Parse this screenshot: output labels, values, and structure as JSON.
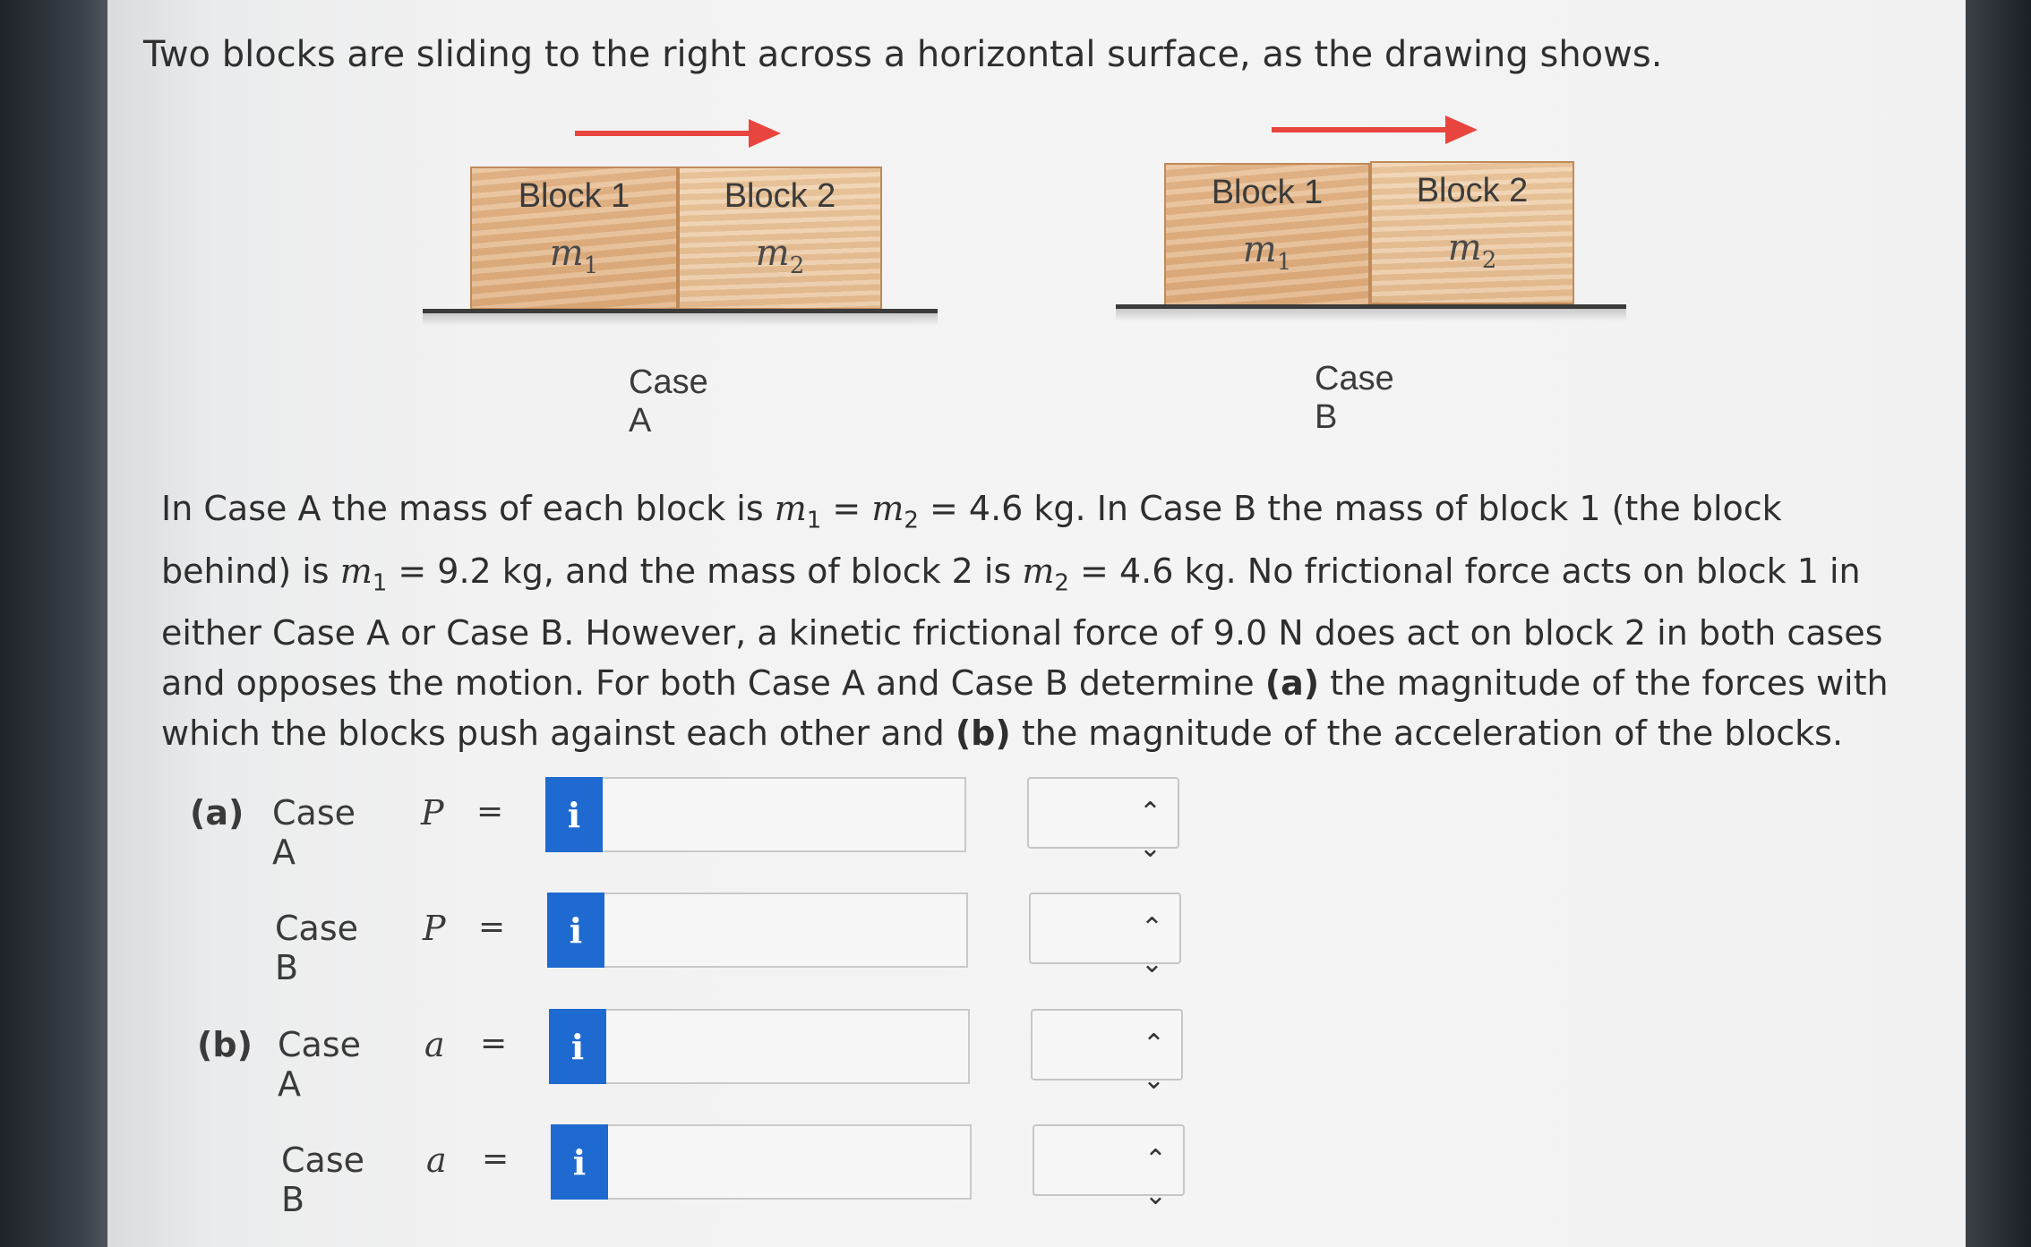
{
  "intro": "Two blocks are sliding to the right across a horizontal surface, as the drawing shows.",
  "figures": [
    {
      "block1_label": "Block 1",
      "block1_mass_symbol": "m",
      "block1_mass_sub": "1",
      "block2_label": "Block 2",
      "block2_mass_symbol": "m",
      "block2_mass_sub": "2",
      "caption": "Case A"
    },
    {
      "block1_label": "Block 1",
      "block1_mass_symbol": "m",
      "block1_mass_sub": "1",
      "block2_label": "Block 2",
      "block2_mass_symbol": "m",
      "block2_mass_sub": "2",
      "caption": "Case B"
    }
  ],
  "problem": {
    "s1": "In Case A the mass of each block is ",
    "m1": "m",
    "sub1": "1",
    "s2": " = ",
    "m2": "m",
    "sub2": "2",
    "s3": " = 4.6 kg. In Case B the mass of block 1 (the block behind) is ",
    "m3": "m",
    "sub3": "1",
    "s4": " = 9.2 kg, and the mass of block 2 is ",
    "m4": "m",
    "sub4": "2",
    "s5": " = 4.6 kg. No frictional force acts on block 1 in either Case A or Case B. However, a kinetic frictional force of 9.0 N does act on block 2 in both cases and opposes the motion. For both Case A and Case B determine ",
    "a": "(a)",
    "s6": " the magnitude of the forces with which the blocks push against each other and ",
    "b": "(b)",
    "s7": " the magnitude of the acceleration of the blocks."
  },
  "answers": [
    {
      "part": "(a)",
      "case": "Case A",
      "var": "P",
      "eq": "=",
      "info": "i",
      "value": "",
      "unit": ""
    },
    {
      "part": "",
      "case": "Case B",
      "var": "P",
      "eq": "=",
      "info": "i",
      "value": "",
      "unit": ""
    },
    {
      "part": "(b)",
      "case": "Case A",
      "var": "a",
      "eq": "=",
      "info": "i",
      "value": "",
      "unit": ""
    },
    {
      "part": "",
      "case": "Case B",
      "var": "a",
      "eq": "=",
      "info": "i",
      "value": "",
      "unit": ""
    }
  ],
  "select_icon": "chevron-up-down-icon",
  "colors": {
    "info_button": "#1f6ad0",
    "arrow": "#e8453e",
    "block_wood": "#e7bb8f"
  }
}
